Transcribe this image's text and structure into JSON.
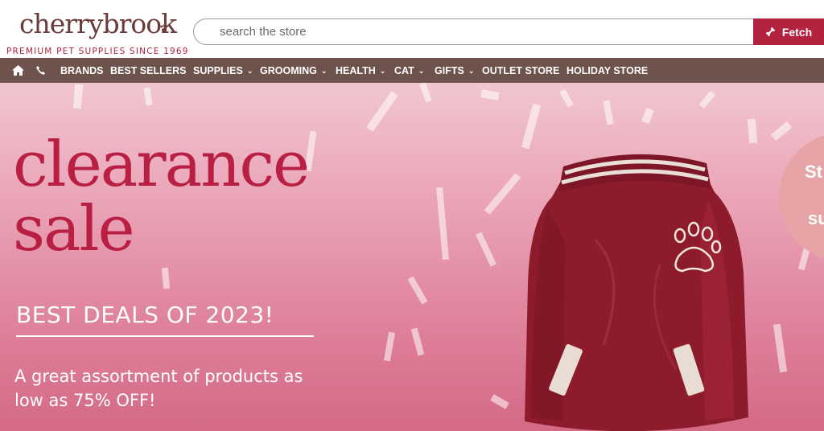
{
  "brand": {
    "name": "cherrybrook",
    "tagline": "PREMIUM PET SUPPLIES SINCE 1969"
  },
  "search": {
    "placeholder": "search the store",
    "button_label": "Fetch"
  },
  "nav": {
    "items": [
      {
        "label": "BRANDS",
        "has_menu": false
      },
      {
        "label": "BEST SELLERS",
        "has_menu": false
      },
      {
        "label": "SUPPLIES",
        "has_menu": true
      },
      {
        "label": "GROOMING",
        "has_menu": true
      },
      {
        "label": "HEALTH",
        "has_menu": true
      },
      {
        "label": "CAT",
        "has_menu": true
      },
      {
        "label": "GIFTS",
        "has_menu": true
      },
      {
        "label": "OUTLET STORE",
        "has_menu": false
      },
      {
        "label": "HOLIDAY STORE",
        "has_menu": false
      }
    ],
    "chevron": "⌄"
  },
  "hero": {
    "headline_line1": "clearance",
    "headline_line2": "sale",
    "subhead": "BEST DEALS OF 2023!",
    "blurb": "A great assortment of products as low as 75% OFF!",
    "badge_text_1": "St",
    "badge_text_2": "su"
  },
  "colors": {
    "brand_red": "#b3223f",
    "nav_bg": "#6e524c",
    "logo_brown": "#6a3b3a",
    "jacket_red": "#8e1b2c"
  },
  "icons": [
    "home-icon",
    "phone-icon",
    "paw-icon",
    "bone-icon",
    "chevron-down-icon"
  ]
}
